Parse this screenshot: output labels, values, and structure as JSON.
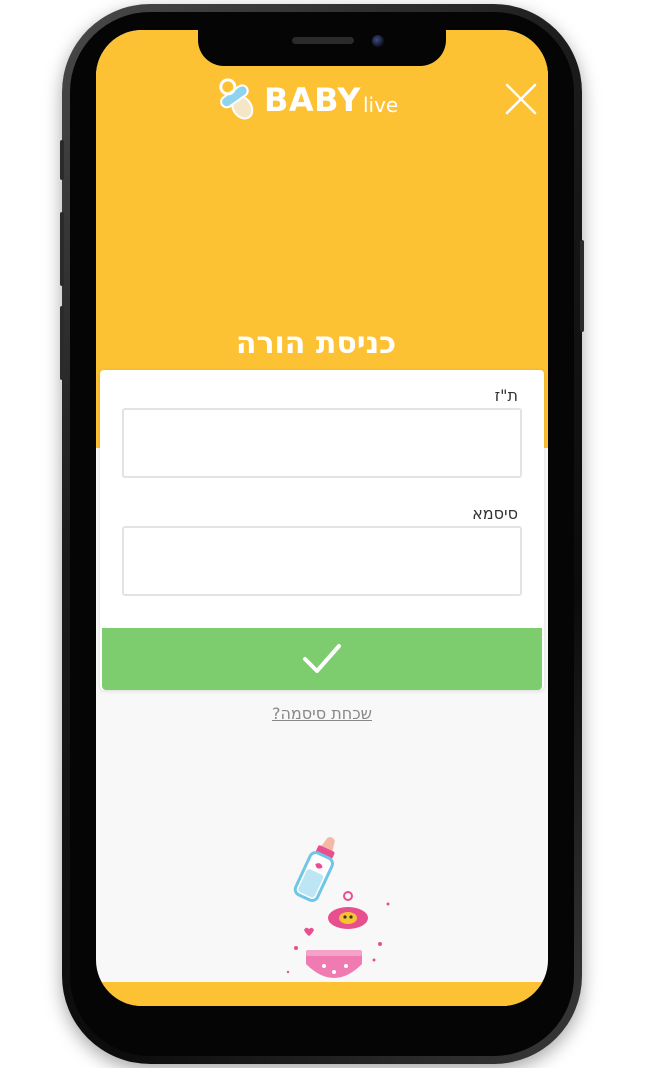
{
  "brand": {
    "name": "BABY",
    "suffix": "live",
    "colors": {
      "primary": "#fdc134",
      "success": "#7dcd6f",
      "accent_pink": "#e84f8f",
      "accent_blue": "#8fd4ec"
    }
  },
  "header": {
    "close_icon": "close-icon"
  },
  "login": {
    "title": "כניסת הורה",
    "id_label": "ת\"ז",
    "id_value": "",
    "password_label": "סיסמא",
    "password_value": "",
    "submit_icon": "checkmark-icon",
    "forgot_password": "שכחת סיסמה?"
  },
  "illustration": {
    "icons": [
      "baby-bottle-icon",
      "pacifier-icon",
      "diaper-icon"
    ]
  }
}
